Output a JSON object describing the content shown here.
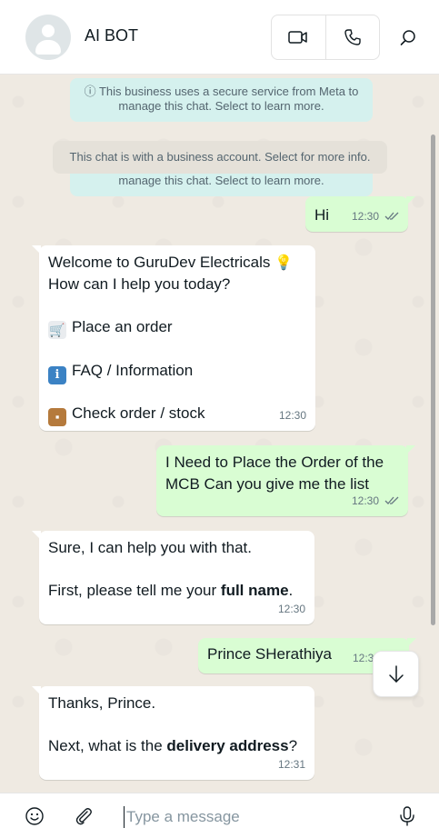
{
  "header": {
    "title": "AI BOT",
    "icons": [
      "avatar",
      "video-call-icon",
      "voice-call-icon",
      "search-icon"
    ]
  },
  "system": {
    "secure_notice": "ⓘ This business uses a secure service from Meta to manage this chat. Select to learn more.",
    "business_notice": "This chat is with a business account. Select for more info."
  },
  "messages": [
    {
      "dir": "out",
      "text": "Hi",
      "time": "12:30",
      "read": true
    },
    {
      "dir": "in",
      "line1": "Welcome to GuruDev Electricals",
      "line2": "How can I help you today?",
      "opt1": "Place an order",
      "opt2": "FAQ / Information",
      "opt3": "Check order / stock",
      "time": "12:30"
    },
    {
      "dir": "out",
      "text": "I Need to Place the Order of the MCB Can you give me the list",
      "time": "12:30",
      "read": true
    },
    {
      "dir": "in",
      "line1": "Sure, I can help you with that.",
      "line2_pre": "First, please tell me your ",
      "line2_bold": "full name",
      "line2_post": ".",
      "time": "12:30"
    },
    {
      "dir": "out",
      "text": "Prince SHerathiya",
      "time": "12:30",
      "read": true
    },
    {
      "dir": "in",
      "line1": "Thanks, Prince.",
      "line2_pre": "Next, what is the ",
      "line2_bold": "delivery address",
      "line2_post": "?",
      "time": "12:31"
    }
  ],
  "composer": {
    "placeholder": "Type a message",
    "value": ""
  },
  "colors": {
    "outgoing_bubble": "#d9fdd3",
    "incoming_bubble": "#ffffff",
    "chat_background": "#efeae2",
    "secure_notice_bg": "#d5f1ee",
    "read_ticks": "#667781"
  }
}
